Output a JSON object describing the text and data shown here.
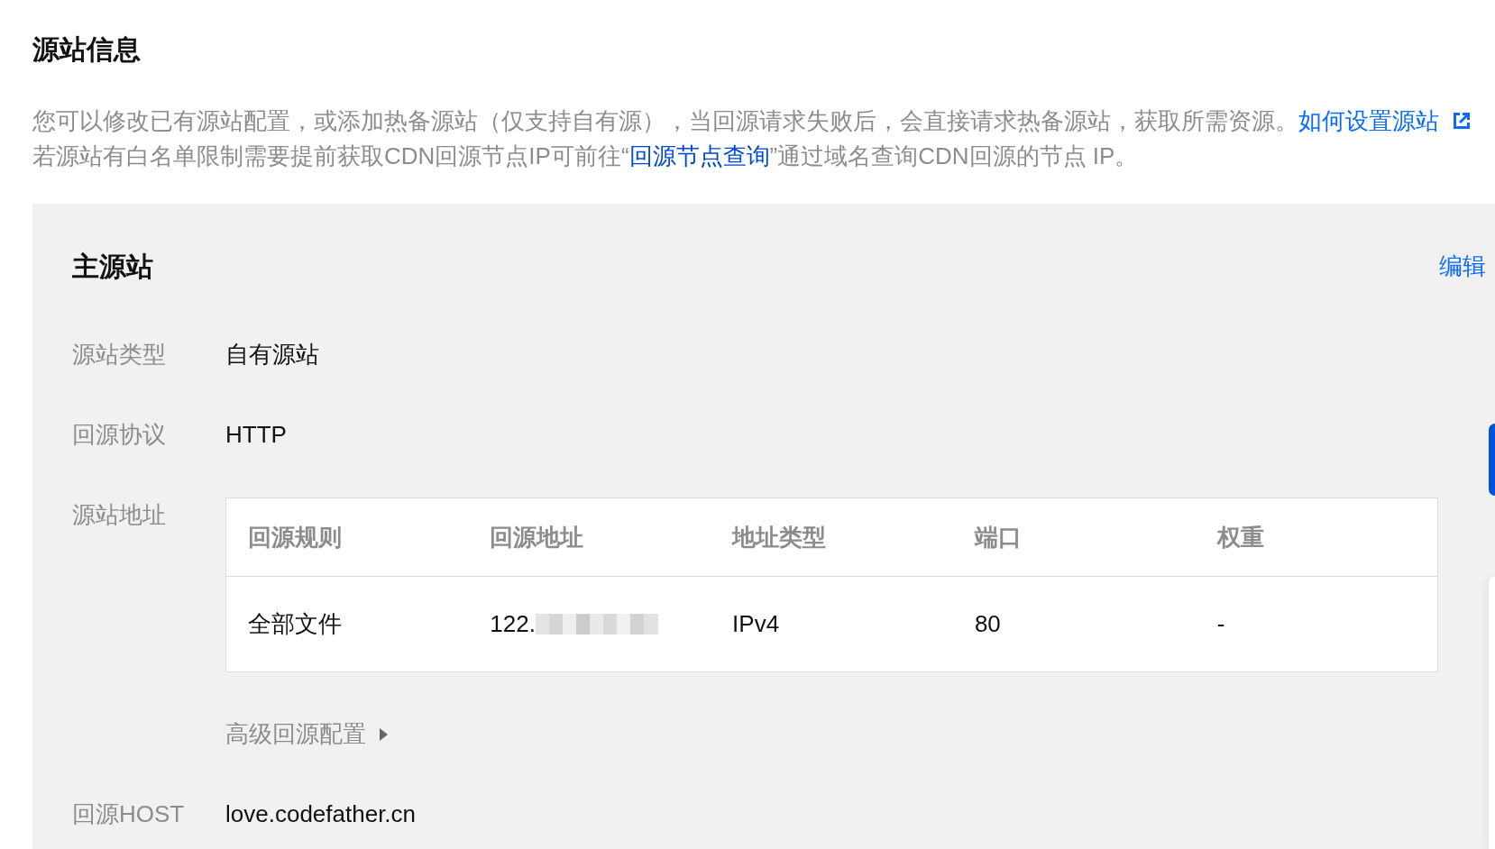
{
  "section": {
    "title": "源站信息",
    "description": [
      [
        {
          "kind": "text",
          "text": "您可以修改已有源站配置，或添加热备源站（仅支持自有源），当回源请求失败后，会直接请求热备源站，获取所需资源。"
        },
        {
          "kind": "external_link",
          "text": "如何设置源站"
        }
      ],
      [
        {
          "kind": "text",
          "text": "若源站有白名单限制需要提前获取CDN回源节点IP可前往“"
        },
        {
          "kind": "link",
          "text": "回源节点查询"
        },
        {
          "kind": "text",
          "text": "”通过域名查询CDN回源的节点 IP。"
        }
      ]
    ]
  },
  "primary_origin": {
    "title": "主源站",
    "edit": "编辑",
    "fields": [
      {
        "kind": "text",
        "label": "源站类型",
        "value": "自有源站"
      },
      {
        "kind": "text",
        "label": "回源协议",
        "value": "HTTP"
      },
      {
        "kind": "table",
        "label": "源站地址",
        "table": {
          "columns": [
            "回源规则",
            "回源地址",
            "地址类型",
            "端口",
            "权重"
          ],
          "rows": [
            {
              "cells": [
                {
                  "text": "全部文件",
                  "redacted": false
                },
                {
                  "text": "122.",
                  "redacted": true
                },
                {
                  "text": "IPv4",
                  "redacted": false
                },
                {
                  "text": "80",
                  "redacted": false
                },
                {
                  "text": "-",
                  "redacted": false
                }
              ]
            }
          ]
        },
        "advanced": {
          "label": "高级回源配置",
          "expanded": false
        }
      },
      {
        "kind": "text",
        "label": "回源HOST",
        "value": "love.codefather.cn"
      }
    ]
  }
}
